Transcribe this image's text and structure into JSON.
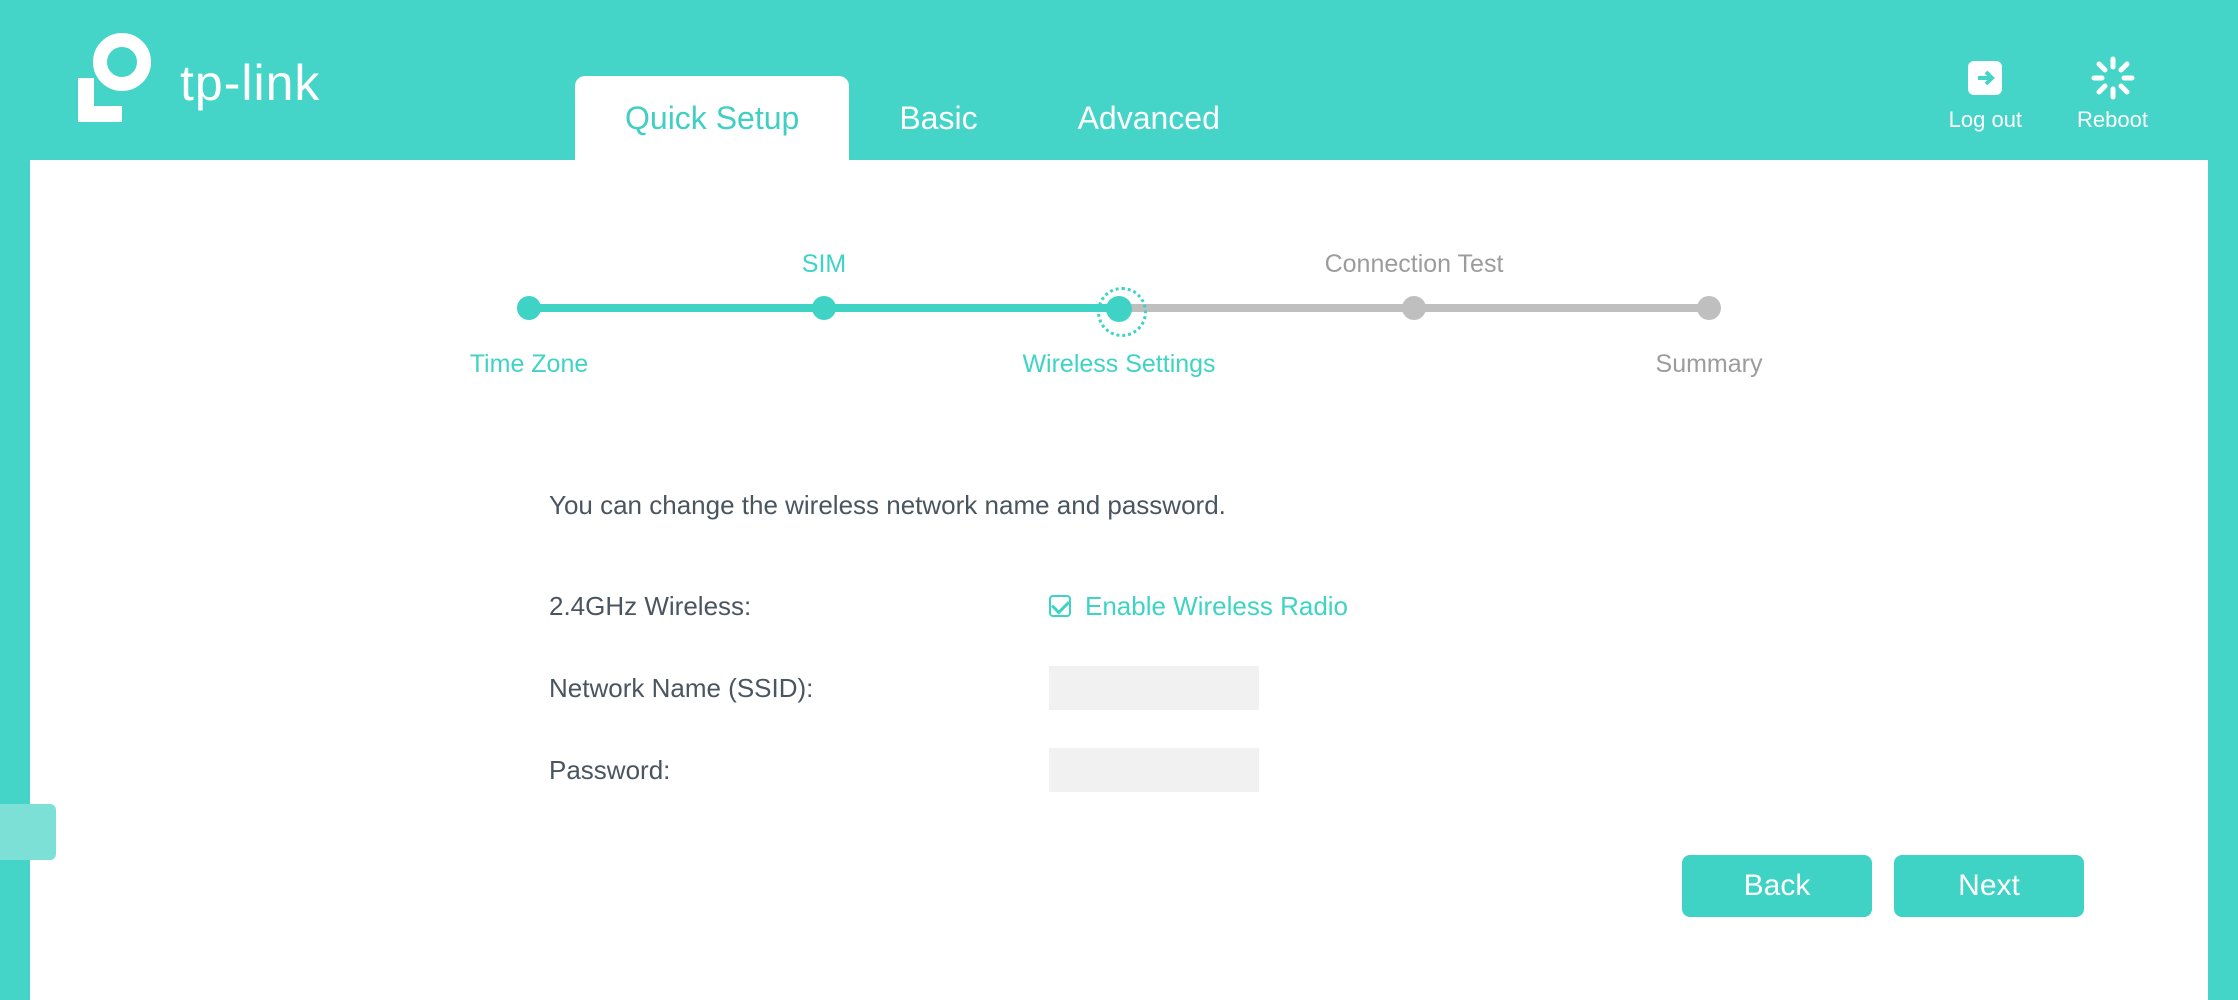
{
  "brand": "tp-link",
  "nav": {
    "tabs": [
      {
        "label": "Quick Setup",
        "active": true
      },
      {
        "label": "Basic",
        "active": false
      },
      {
        "label": "Advanced",
        "active": false
      }
    ],
    "actions": {
      "logout": "Log out",
      "reboot": "Reboot"
    }
  },
  "stepper": {
    "steps": [
      {
        "label": "Time Zone",
        "pos": 0,
        "row": "bottom",
        "state": "done"
      },
      {
        "label": "SIM",
        "pos": 0.25,
        "row": "top",
        "state": "done"
      },
      {
        "label": "Wireless Settings",
        "pos": 0.5,
        "row": "bottom",
        "state": "current"
      },
      {
        "label": "Connection Test",
        "pos": 0.75,
        "row": "top",
        "state": "todo"
      },
      {
        "label": "Summary",
        "pos": 1,
        "row": "bottom",
        "state": "todo"
      }
    ]
  },
  "form": {
    "instruction": "You can change the wireless network name and password.",
    "wireless_label": "2.4GHz Wireless:",
    "enable_radio_label": "Enable Wireless Radio",
    "enable_radio_checked": true,
    "ssid_label": "Network Name (SSID):",
    "ssid_value": "",
    "password_label": "Password:",
    "password_value": ""
  },
  "buttons": {
    "back": "Back",
    "next": "Next"
  }
}
